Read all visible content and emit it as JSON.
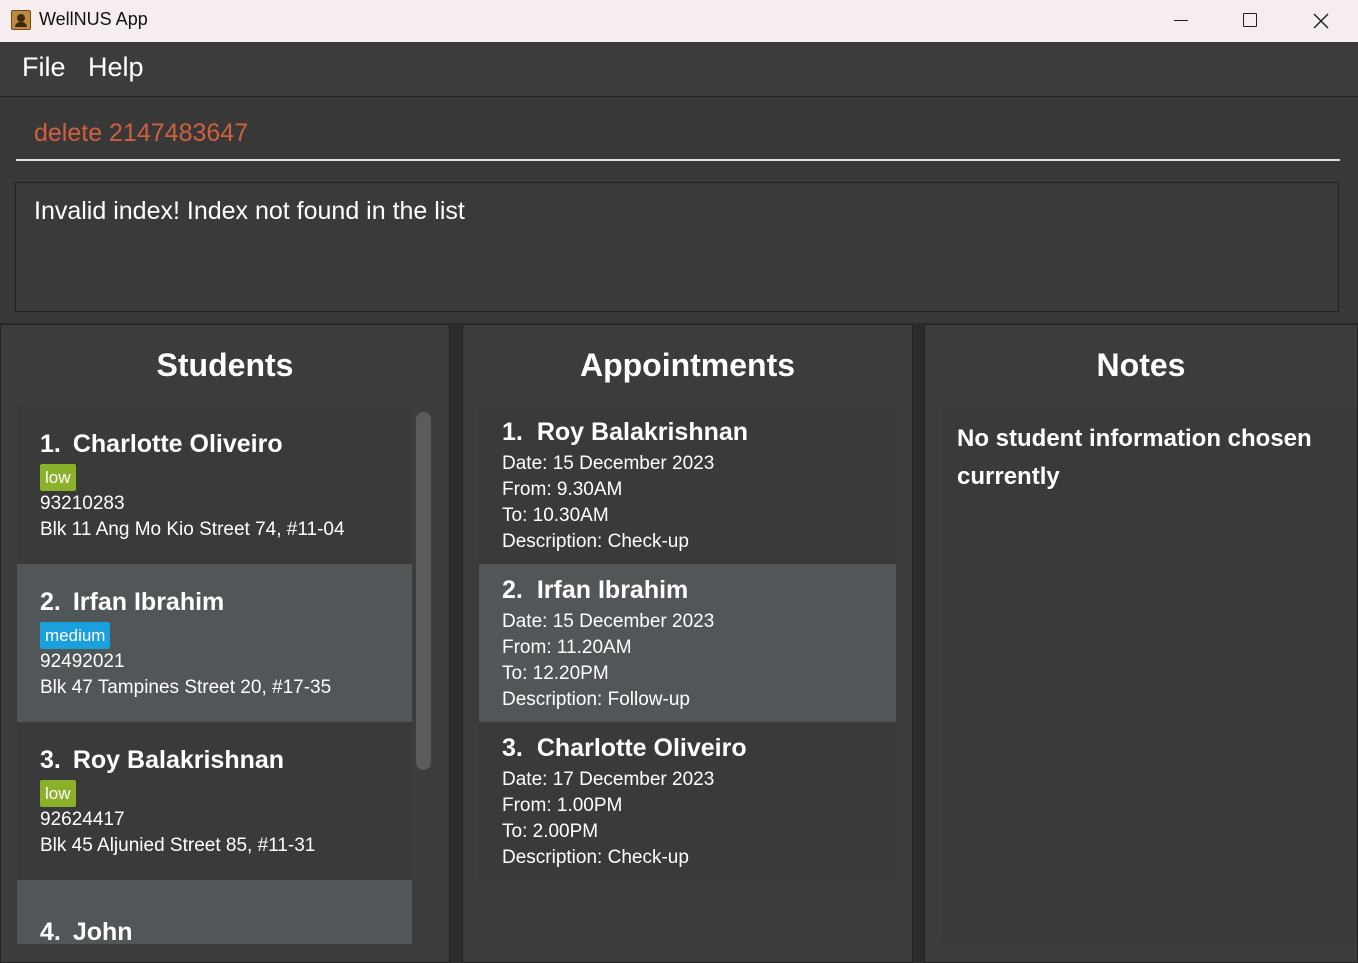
{
  "window": {
    "title": "WellNUS App"
  },
  "menu": {
    "items": [
      "File",
      "Help"
    ]
  },
  "command": {
    "value": "delete 2147483647"
  },
  "result": {
    "message": "Invalid index! Index not found in the list"
  },
  "students": {
    "title": "Students",
    "items": [
      {
        "index": "1.",
        "name": "Charlotte Oliveiro",
        "tag": "low",
        "phone": "93210283",
        "address": "Blk 11 Ang Mo Kio Street 74, #11-04"
      },
      {
        "index": "2.",
        "name": "Irfan Ibrahim",
        "tag": "medium",
        "phone": "92492021",
        "address": "Blk 47 Tampines Street 20, #17-35"
      },
      {
        "index": "3.",
        "name": "Roy Balakrishnan",
        "tag": "low",
        "phone": "92624417",
        "address": "Blk 45 Aljunied Street 85, #11-31"
      },
      {
        "index": "4.",
        "name": "John"
      }
    ]
  },
  "appointments": {
    "title": "Appointments",
    "items": [
      {
        "index": "1.",
        "name": "Roy Balakrishnan",
        "date": "Date: 15 December 2023",
        "from": "From: 9.30AM",
        "to": "To: 10.30AM",
        "description": "Description: Check-up"
      },
      {
        "index": "2.",
        "name": "Irfan Ibrahim",
        "date": "Date: 15 December 2023",
        "from": "From: 11.20AM",
        "to": "To: 12.20PM",
        "description": "Description: Follow-up"
      },
      {
        "index": "3.",
        "name": "Charlotte Oliveiro",
        "date": "Date: 17 December 2023",
        "from": "From: 1.00PM",
        "to": "To: 2.00PM",
        "description": "Description: Check-up"
      }
    ]
  },
  "notes": {
    "title": "Notes",
    "message": "No student information chosen currently"
  },
  "colors": {
    "tag_low": "#8bb02a",
    "tag_medium": "#1aa1dd",
    "command_text": "#d0603e"
  }
}
